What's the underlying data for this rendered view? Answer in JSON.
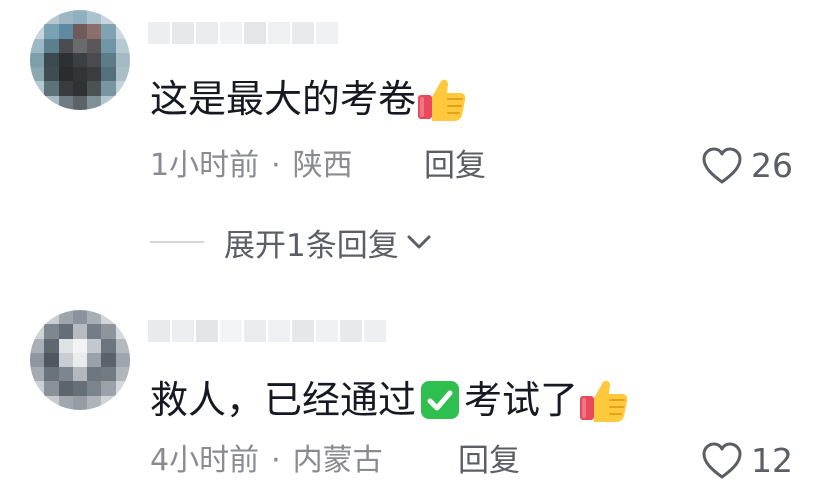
{
  "comments": [
    {
      "text": "这是最大的考卷",
      "time": "1小时前",
      "separator": "·",
      "location": "陕西",
      "reply_label": "回复",
      "likes": "26",
      "trailing_emoji": "thumbs-up"
    },
    {
      "text_before": "救人，已经通过",
      "text_after": "考试了",
      "time": "4小时前",
      "separator": "·",
      "location": "内蒙古",
      "reply_label": "回复",
      "likes": "12",
      "inline_emoji": "check-mark",
      "trailing_emoji": "thumbs-up"
    }
  ],
  "expand_replies": {
    "label": "展开1条回复"
  },
  "colors": {
    "text_primary": "#161823",
    "text_secondary": "#8a8b91",
    "reply": "#5c5e66",
    "check_green": "#2fbf4f",
    "thumb_yellow": "#ffc83d",
    "cuff_red": "#e8495c"
  }
}
